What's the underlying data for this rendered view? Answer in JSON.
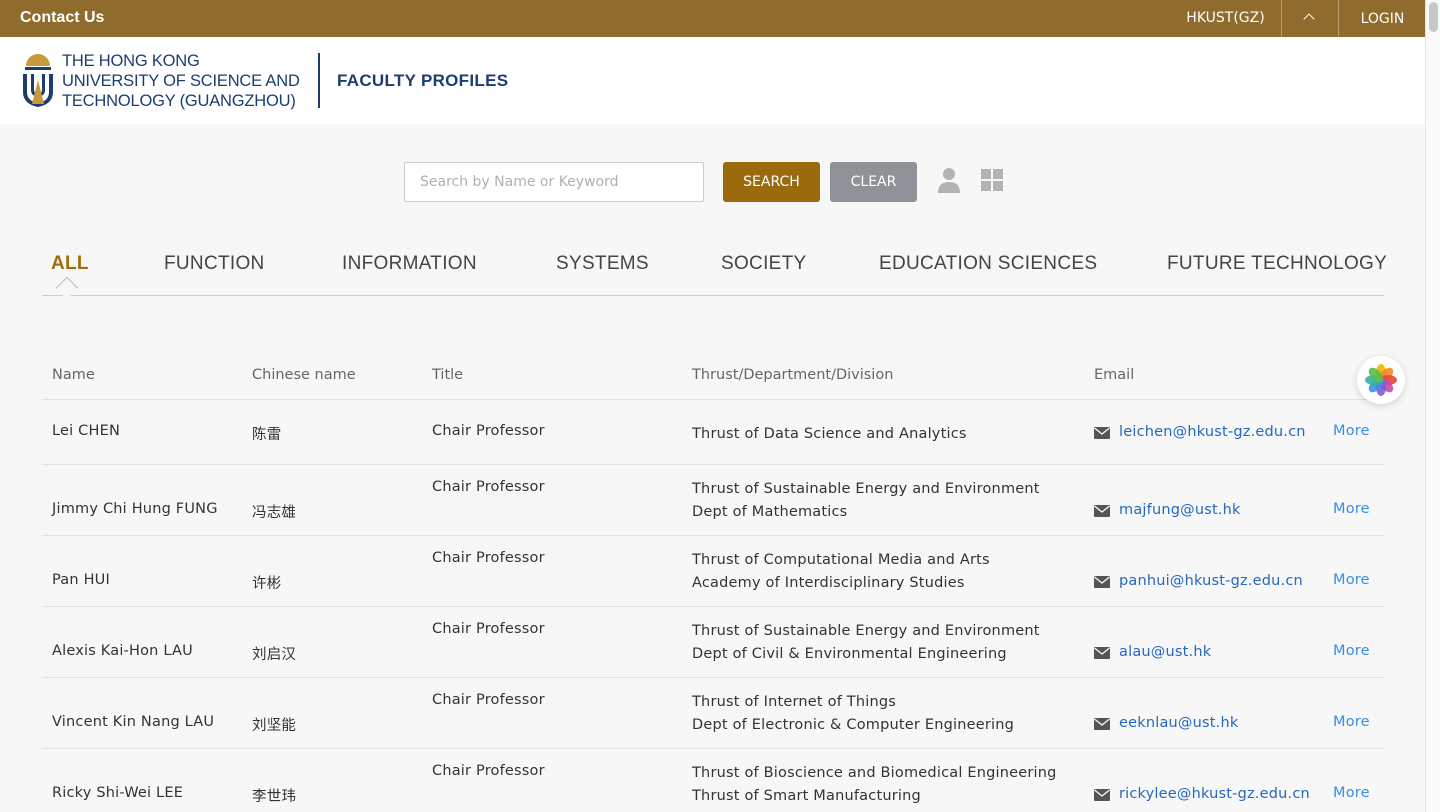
{
  "topbar": {
    "contact_label": "Contact Us",
    "campus_label": "HKUST(GZ)",
    "login_label": "LOGIN"
  },
  "header": {
    "logo_lines": [
      "THE HONG KONG",
      "UNIVERSITY OF SCIENCE AND",
      "TECHNOLOGY (GUANGZHOU)"
    ],
    "section_title": "FACULTY PROFILES"
  },
  "search": {
    "placeholder": "Search by Name or Keyword",
    "value": "",
    "search_label": "SEARCH",
    "clear_label": "CLEAR"
  },
  "view_toggle": {
    "list_icon": "person-icon",
    "grid_icon": "grid-icon"
  },
  "tabs": [
    {
      "label": "ALL",
      "active": true
    },
    {
      "label": "FUNCTION",
      "active": false
    },
    {
      "label": "INFORMATION",
      "active": false
    },
    {
      "label": "SYSTEMS",
      "active": false
    },
    {
      "label": "SOCIETY",
      "active": false
    },
    {
      "label": "EDUCATION SCIENCES",
      "active": false
    },
    {
      "label": "FUTURE TECHNOLOGY",
      "active": false
    }
  ],
  "table": {
    "headers": {
      "name": "Name",
      "chinese_name": "Chinese name",
      "title": "Title",
      "dept": "Thrust/Department/Division",
      "email": "Email"
    },
    "more_label": "More",
    "rows": [
      {
        "name": "Lei CHEN",
        "chinese": "陈雷",
        "title": "Chair Professor",
        "dept": [
          "Thrust of Data Science and Analytics"
        ],
        "email": "leichen@hkust-gz.edu.cn"
      },
      {
        "name": "Jimmy Chi Hung FUNG",
        "chinese": "冯志雄",
        "title": "Chair Professor",
        "dept": [
          "Thrust of Sustainable Energy and Environment",
          "Dept of Mathematics"
        ],
        "email": "majfung@ust.hk"
      },
      {
        "name": "Pan HUI",
        "chinese": "许彬",
        "title": "Chair Professor",
        "dept": [
          "Thrust of Computational Media and Arts",
          "Academy of Interdisciplinary Studies"
        ],
        "email": "panhui@hkust-gz.edu.cn"
      },
      {
        "name": "Alexis Kai-Hon LAU",
        "chinese": "刘启汉",
        "title": "Chair Professor",
        "dept": [
          "Thrust of Sustainable Energy and Environment",
          "Dept of Civil & Environmental Engineering"
        ],
        "email": "alau@ust.hk"
      },
      {
        "name": "Vincent Kin Nang LAU",
        "chinese": "刘坚能",
        "title": "Chair Professor",
        "dept": [
          "Thrust of Internet of Things",
          "Dept of Electronic & Computer Engineering"
        ],
        "email": "eeknlau@ust.hk"
      },
      {
        "name": "Ricky Shi-Wei LEE",
        "chinese": "李世玮",
        "title": "Chair Professor",
        "dept": [
          "Thrust of Bioscience and Biomedical Engineering",
          "Thrust of Smart Manufacturing"
        ],
        "email": "rickylee@hkust-gz.edu.cn"
      }
    ]
  },
  "colors": {
    "topbar": "#8f6b2e",
    "brand_navy": "#1c3e6e",
    "search_button": "#9a6a0d",
    "clear_button": "#8f9398",
    "active_tab": "#a16c0b",
    "link": "#2667c0"
  },
  "floating_widget_icon": "flower-icon"
}
